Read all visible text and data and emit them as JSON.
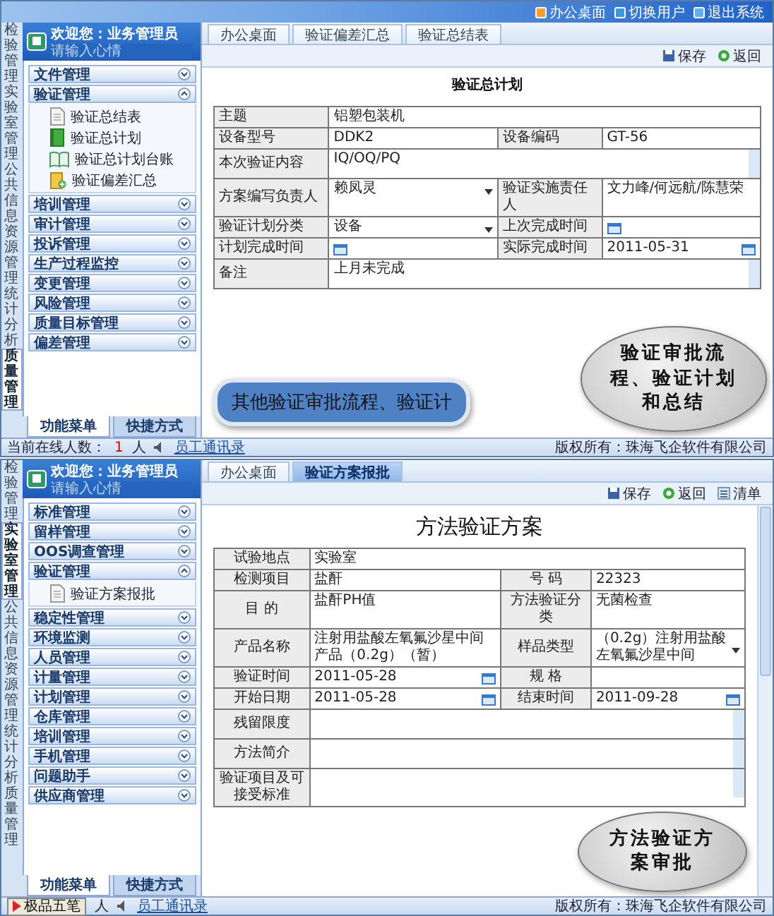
{
  "panels": [
    {
      "header_links": [
        "办公桌面",
        "切换用户",
        "退出系统"
      ],
      "user": {
        "greeting": "欢迎您：业务管理员",
        "mood_placeholder": "请输入心情"
      },
      "side_tabs": [
        {
          "label": "检验管理",
          "selected": false
        },
        {
          "label": "实验室管理",
          "selected": false
        },
        {
          "label": "公共信息",
          "selected": false
        },
        {
          "label": "资源管理",
          "selected": false
        },
        {
          "label": "统计分析",
          "selected": false
        },
        {
          "label": "质量管理",
          "selected": true
        }
      ],
      "menu": [
        {
          "label": "文件管理",
          "expanded": false
        },
        {
          "label": "验证管理",
          "expanded": true,
          "children": [
            {
              "label": "验证总结表",
              "kind": "document"
            },
            {
              "label": "验证总计划",
              "kind": "book"
            },
            {
              "label": "验证总计划台账",
              "kind": "open-book"
            },
            {
              "label": "验证偏差汇总",
              "kind": "clipboard"
            }
          ]
        },
        {
          "label": "培训管理",
          "expanded": false
        },
        {
          "label": "审计管理",
          "expanded": false
        },
        {
          "label": "投诉管理",
          "expanded": false
        },
        {
          "label": "生产过程监控",
          "expanded": false
        },
        {
          "label": "变更管理",
          "expanded": false
        },
        {
          "label": "风险管理",
          "expanded": false
        },
        {
          "label": "质量目标管理",
          "expanded": false
        },
        {
          "label": "偏差管理",
          "expanded": false
        }
      ],
      "bottom_tabs": [
        {
          "label": "功能菜单",
          "selected": true
        },
        {
          "label": "快捷方式",
          "selected": false
        }
      ],
      "tabs": [
        {
          "label": "办公桌面",
          "selected": false
        },
        {
          "label": "验证偏差汇总",
          "selected": false
        },
        {
          "label": "验证总结表",
          "selected": false
        }
      ],
      "toolbar": [
        {
          "label": "保存",
          "kind": "save"
        },
        {
          "label": "返回",
          "kind": "back"
        }
      ],
      "form": {
        "title": "验证总计划",
        "rows": [
          [
            {
              "kind": "label",
              "value": "主题"
            },
            {
              "kind": "text",
              "value": "铝塑包装机",
              "colspan": 3
            }
          ],
          [
            {
              "kind": "label",
              "value": "设备型号"
            },
            {
              "kind": "text",
              "value": "DDK2"
            },
            {
              "kind": "label",
              "value": "设备编码"
            },
            {
              "kind": "text",
              "value": "GT-56"
            }
          ],
          [
            {
              "kind": "label",
              "value": "本次验证内容"
            },
            {
              "kind": "textarea",
              "value": "IQ/OQ/PQ",
              "colspan": 3
            }
          ],
          [
            {
              "kind": "label",
              "value": "方案编写负责人"
            },
            {
              "kind": "select",
              "value": "赖凤灵"
            },
            {
              "kind": "label",
              "value": "验证实施责任人"
            },
            {
              "kind": "text",
              "value": "文力峰/何远航/陈慧荣"
            }
          ],
          [
            {
              "kind": "label",
              "value": "验证计划分类"
            },
            {
              "kind": "select",
              "value": "设备"
            },
            {
              "kind": "label",
              "value": "上次完成时间"
            },
            {
              "kind": "date"
            }
          ],
          [
            {
              "kind": "label",
              "value": "计划完成时间"
            },
            {
              "kind": "date"
            },
            {
              "kind": "label",
              "value": "实际完成时间"
            },
            {
              "kind": "date",
              "value": "2011-05-31"
            }
          ],
          [
            {
              "kind": "label",
              "value": "备注"
            },
            {
              "kind": "textarea",
              "value": "上月未完成",
              "colspan": 3
            }
          ]
        ]
      },
      "status_bar": {
        "online_label": "当前在线人数：",
        "online_count": "1",
        "online_unit": "人",
        "link": "员工通讯录",
        "copyright": "版权所有：珠海飞企软件有限公司"
      },
      "callouts": [
        {
          "kind": "banner",
          "text": "其他验证审批流程、验证计"
        },
        {
          "kind": "bubble",
          "text": "验证审批流程、验证计划和总结"
        }
      ]
    },
    {
      "user": {
        "greeting": "欢迎您：业务管理员",
        "mood_placeholder": "请输入心情"
      },
      "side_tabs": [
        {
          "label": "检验管理",
          "selected": false
        },
        {
          "label": "实验室管理",
          "selected": true
        },
        {
          "label": "公共信息",
          "selected": false
        },
        {
          "label": "资源管理",
          "selected": false
        },
        {
          "label": "统计分析",
          "selected": false
        },
        {
          "label": "质量管理",
          "selected": false
        }
      ],
      "menu": [
        {
          "label": "标准管理",
          "expanded": false
        },
        {
          "label": "留样管理",
          "expanded": false
        },
        {
          "label": "OOS调查管理",
          "expanded": false
        },
        {
          "label": "验证管理",
          "expanded": true,
          "children": [
            {
              "label": "验证方案报批",
              "kind": "document"
            }
          ]
        },
        {
          "label": "稳定性管理",
          "expanded": false
        },
        {
          "label": "环境监测",
          "expanded": false
        },
        {
          "label": "人员管理",
          "expanded": false
        },
        {
          "label": "计量管理",
          "expanded": false
        },
        {
          "label": "计划管理",
          "expanded": false
        },
        {
          "label": "仓库管理",
          "expanded": false
        },
        {
          "label": "培训管理",
          "expanded": false
        },
        {
          "label": "手机管理",
          "expanded": false
        },
        {
          "label": "问题助手",
          "expanded": false
        },
        {
          "label": "供应商管理",
          "expanded": false
        }
      ],
      "bottom_tabs": [
        {
          "label": "功能菜单",
          "selected": true
        },
        {
          "label": "快捷方式",
          "selected": false
        }
      ],
      "tabs": [
        {
          "label": "办公桌面",
          "selected": false
        },
        {
          "label": "验证方案报批",
          "selected": true
        }
      ],
      "toolbar": [
        {
          "label": "保存",
          "kind": "save"
        },
        {
          "label": "返回",
          "kind": "back"
        },
        {
          "label": "清单",
          "kind": "list"
        }
      ],
      "form": {
        "title": "方法验证方案",
        "rows": [
          [
            {
              "kind": "label",
              "value": "试验地点"
            },
            {
              "kind": "text",
              "value": "实验室",
              "colspan": 3
            }
          ],
          [
            {
              "kind": "label",
              "value": "检测项目"
            },
            {
              "kind": "text",
              "value": "盐酐"
            },
            {
              "kind": "label",
              "value": "号 码"
            },
            {
              "kind": "text",
              "value": "22323"
            }
          ],
          [
            {
              "kind": "label",
              "value": "目 的"
            },
            {
              "kind": "text",
              "value": "盐酐PH值"
            },
            {
              "kind": "label",
              "value": "方法验证分类"
            },
            {
              "kind": "text",
              "value": "无菌检查"
            }
          ],
          [
            {
              "kind": "label",
              "value": "产品名称"
            },
            {
              "kind": "text",
              "value": "注射用盐酸左氧氟沙星中间产品（0.2g）（暂）"
            },
            {
              "kind": "label",
              "value": "样品类型"
            },
            {
              "kind": "select",
              "value": "（0.2g）注射用盐酸左氧氟沙星中间"
            }
          ],
          [
            {
              "kind": "label",
              "value": "验证时间"
            },
            {
              "kind": "date",
              "value": "2011-05-28"
            },
            {
              "kind": "label",
              "value": "规 格"
            },
            {
              "kind": "text"
            }
          ],
          [
            {
              "kind": "label",
              "value": "开始日期"
            },
            {
              "kind": "date",
              "value": "2011-05-28"
            },
            {
              "kind": "label",
              "value": "结束时间"
            },
            {
              "kind": "date",
              "value": "2011-09-28"
            }
          ],
          [
            {
              "kind": "label",
              "value": "残留限度"
            },
            {
              "kind": "textarea",
              "colspan": 3
            }
          ],
          [
            {
              "kind": "label",
              "value": "方法简介"
            },
            {
              "kind": "textarea",
              "colspan": 3
            }
          ],
          [
            {
              "kind": "label",
              "value": "验证项目及可接受标准"
            },
            {
              "kind": "textarea",
              "colspan": 3
            }
          ]
        ]
      },
      "status_bar": {
        "ime": "极品五笔",
        "online_unit": "人",
        "link": "员工通讯录",
        "copyright": "版权所有：珠海飞企软件有限公司"
      },
      "callouts": [
        {
          "kind": "bubble",
          "text": "方法验证方案审批"
        }
      ]
    }
  ]
}
